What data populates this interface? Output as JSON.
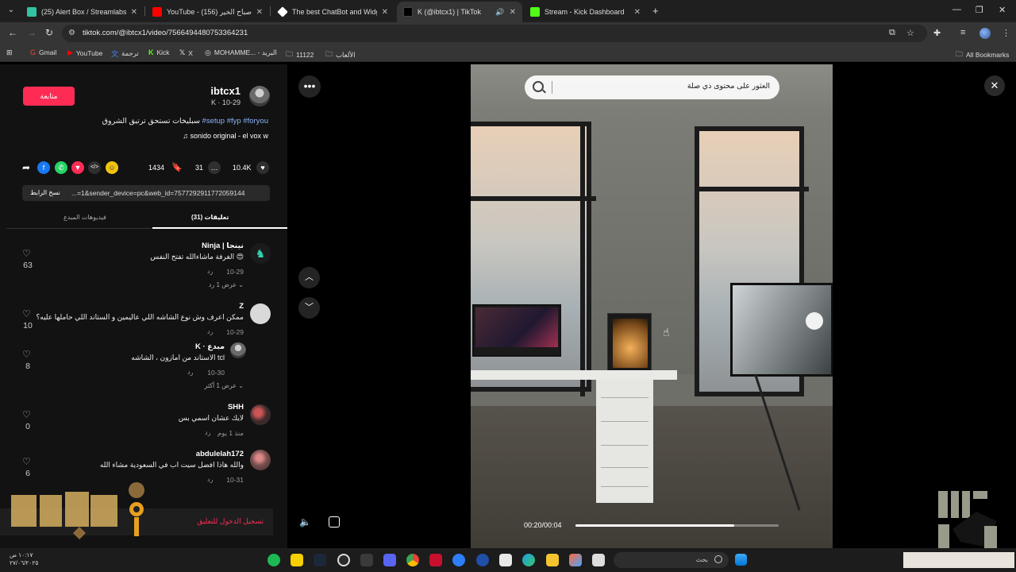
{
  "browser": {
    "tabs": [
      {
        "title": "(25) Alert Box / Streamlabs",
        "favicon_color": "#31c3a2"
      },
      {
        "title": "YouTube - صباح الخير (156)",
        "favicon_color": "#ff0000"
      },
      {
        "title": "The best ChatBot and Widgets",
        "favicon_color": "#ffffff"
      },
      {
        "title": "K (@ibtcx1) | TikTok",
        "favicon_color": "#000000"
      },
      {
        "title": "Stream - Kick Dashboard",
        "favicon_color": "#53fc18"
      }
    ],
    "url": "tiktok.com/@ibtcx1/video/7566494480753364231",
    "bookmarks": [
      "Gmail",
      "YouTube",
      "ترجمة",
      "Kick",
      "X",
      "MOHAMME... - البريد",
      "11122",
      "الألعاب"
    ],
    "all_bookmarks": "All Bookmarks"
  },
  "post": {
    "follow_label": "متابعة",
    "author": "ibtcx1",
    "meta": "K · 10-29",
    "caption_text": "سبليخات تستحق ترتيق الشروق",
    "caption_tags": "#setup #fyp #foryou",
    "sound": "♫ sonido original - el vox w",
    "likes": "10.4K",
    "comments": "31",
    "saves": "1434",
    "copy_link": "نسخ الرابط",
    "share_url": "...=1&sender_device=pc&web_id=7577292911772059144",
    "tab_comments": "تعليقات (31)",
    "tab_creator_videos": "فيديوهات المبدع"
  },
  "comments": [
    {
      "name": "Ninja | نينجا",
      "text": "الغرفة ماشاءالله تفتح النفس 😍",
      "date": "10-29",
      "reply": "رد",
      "likes": "63",
      "more": "عرض 1 رد ⌄"
    },
    {
      "name": "Z",
      "text": "ممكن اعرف وش نوع الشاشه اللي عاليمين و الستاند اللي حاملها عليه؟",
      "date": "10-29",
      "reply": "رد",
      "likes": "10",
      "more": ""
    },
    {
      "name": "K · مبدع",
      "text": "الاستاند من امازون ، الشاشه tcl",
      "date": "10-30",
      "reply": "رد",
      "likes": "8",
      "more": "عرض 1 أكثر ⌄"
    },
    {
      "name": "SHH",
      "text": "لايك عشان اسمي بس",
      "date": "منذ 1 يوم",
      "reply": "رد",
      "likes": "0",
      "more": ""
    },
    {
      "name": "abdulelah172",
      "text": "والله هاذا افضل سيت اب في السعودية مشاء الله",
      "date": "10-31",
      "reply": "رد",
      "likes": "6",
      "more": ""
    }
  ],
  "login_prompt": "تسجيل الدخول للتعليق",
  "video": {
    "search_placeholder": "العثور على محتوى ذي صلة",
    "time": "00:20/00:04",
    "progress": 0.78
  },
  "taskbar": {
    "search_placeholder": "بحث",
    "clock_time": "١٠:١٧ ص",
    "clock_date": "٢٧/٠٦/٢٠٢٥"
  }
}
